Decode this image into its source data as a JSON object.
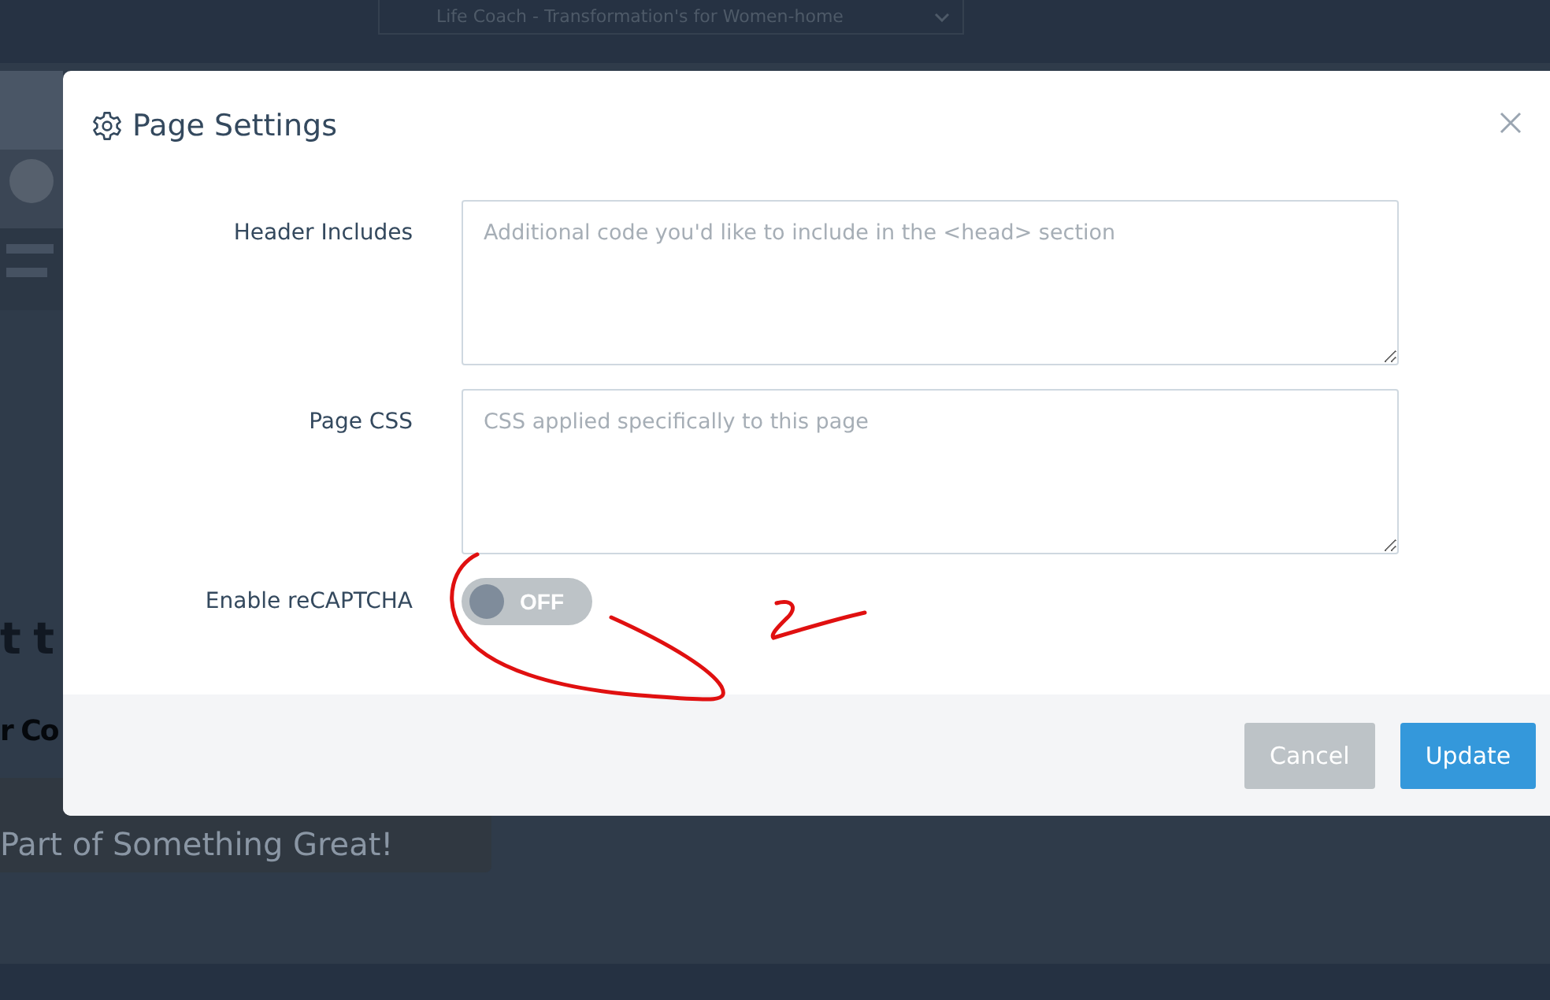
{
  "background": {
    "page_select": "Life Coach - Transformation's for Women-home",
    "heading_fragment": "t t",
    "subheading_fragment": "r Co",
    "cta_button": "Part of Something Great!"
  },
  "dialog": {
    "title": "Page Settings",
    "fields": [
      {
        "kind": "textarea",
        "label": "Header Includes",
        "placeholder": "Additional code you'd like to include in the <head> section"
      },
      {
        "kind": "textarea",
        "label": "Page CSS",
        "placeholder": "CSS applied specifically to this page"
      },
      {
        "kind": "toggle",
        "label": "Enable reCAPTCHA",
        "on": false,
        "state_text": "OFF"
      }
    ],
    "buttons": [
      {
        "label": "Cancel",
        "kind": "secondary"
      },
      {
        "label": "Update",
        "kind": "primary"
      }
    ]
  }
}
